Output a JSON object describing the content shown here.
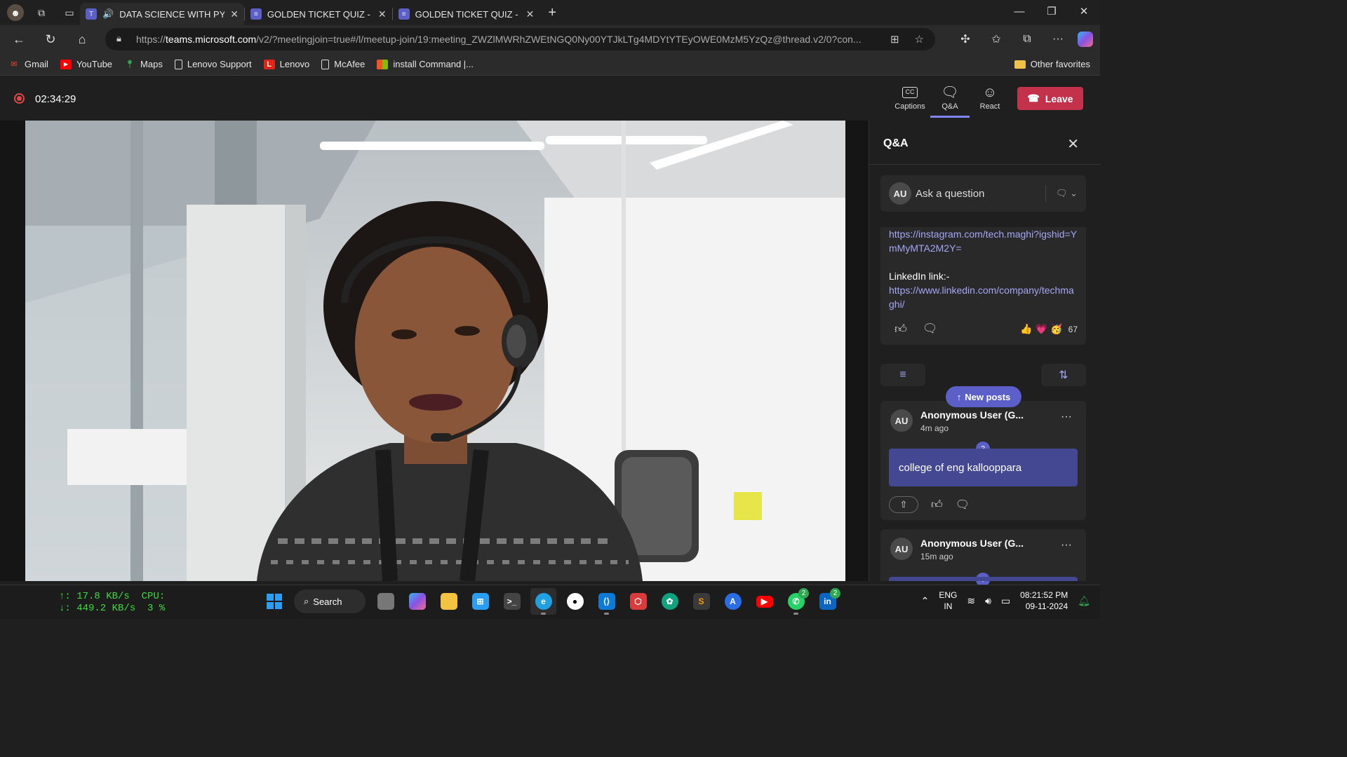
{
  "browser": {
    "tabs": [
      {
        "title": "DATA SCIENCE WITH PYTHON",
        "active": true,
        "audio": true
      },
      {
        "title": "GOLDEN TICKET QUIZ - DATA SCIENCE",
        "active": false
      },
      {
        "title": "GOLDEN TICKET QUIZ - DATA SCIENCE",
        "active": false
      }
    ],
    "url_prefix": "https://",
    "url_host": "teams.microsoft.com",
    "url_path": "/v2/?meetingjoin=true#/l/meetup-join/19:meeting_ZWZlMWRhZWEtNGQ0Ny00YTJkLTg4MDYtYTEyOWE0MzM5YzQz@thread.v2/0?con...",
    "bookmarks": [
      {
        "label": "Gmail",
        "icon": "gmail-icon",
        "color": "#ea4335"
      },
      {
        "label": "YouTube",
        "icon": "youtube-icon",
        "color": "#ff0000"
      },
      {
        "label": "Maps",
        "icon": "maps-pin-icon",
        "color": "#34a853"
      },
      {
        "label": "Lenovo Support",
        "icon": "page-icon",
        "color": "#dddddd"
      },
      {
        "label": "Lenovo",
        "icon": "lenovo-icon",
        "color": "#e2231a"
      },
      {
        "label": "McAfee",
        "icon": "page-icon",
        "color": "#dddddd"
      },
      {
        "label": "install Command |...",
        "icon": "windows-logo-icon",
        "color": "#f35325"
      }
    ],
    "other_favorites": "Other favorites"
  },
  "meeting": {
    "timer": "02:34:29",
    "buttons": {
      "captions": "Captions",
      "qa": "Q&A",
      "react": "React",
      "leave": "Leave"
    },
    "colors": {
      "leave": "#c4314b",
      "accent": "#7f85f5",
      "recording": "#e04848"
    }
  },
  "qa": {
    "title": "Q&A",
    "ask": {
      "avatar": "AU",
      "placeholder": "Ask a question"
    },
    "pinned": {
      "lines": [
        {
          "kind": "link",
          "text": "https://instagram.com/tech.maghi?igshid=YmMyMTA2M2Y="
        },
        {
          "kind": "text",
          "text": "LinkedIn link:-"
        },
        {
          "kind": "link",
          "text": "https://www.linkedin.com/company/techmaghi/"
        }
      ],
      "reactions": [
        "👍",
        "💗",
        "🥳"
      ],
      "reaction_count": "67"
    },
    "new_posts": "New posts",
    "posts": [
      {
        "avatar": "AU",
        "author": "Anonymous User (G...",
        "time": "4m ago",
        "question": "college of eng kallooppara"
      },
      {
        "avatar": "AU",
        "author": "Anonymous User (G...",
        "time": "15m ago",
        "question": ""
      }
    ]
  },
  "taskbar": {
    "net_up": "↑: 17.8 KB/s",
    "net_down": "↓: 449.2 KB/s",
    "cpu_label": "CPU:",
    "cpu_value": "3 %",
    "search": "Search",
    "apps": [
      {
        "name": "windows-start",
        "color": "#2a9df4"
      },
      {
        "name": "task-view",
        "color": "#777777"
      },
      {
        "name": "copilot",
        "color": "#8a52e3"
      },
      {
        "name": "file-explorer",
        "color": "#f5c342"
      },
      {
        "name": "microsoft-store",
        "color": "#2a9df4"
      },
      {
        "name": "terminal",
        "color": "#444444"
      },
      {
        "name": "edge",
        "color": "#1fa0e2"
      },
      {
        "name": "github",
        "color": "#222222"
      },
      {
        "name": "vscode",
        "color": "#0e7ad8"
      },
      {
        "name": "app-red",
        "color": "#d83b3b"
      },
      {
        "name": "chatgpt",
        "color": "#10a37f"
      },
      {
        "name": "sublime",
        "color": "#ff9800"
      },
      {
        "name": "app-store",
        "color": "#2a6de4"
      },
      {
        "name": "youtube",
        "color": "#ff0000"
      },
      {
        "name": "whatsapp",
        "color": "#25d366",
        "badge": "2"
      },
      {
        "name": "linkedin",
        "color": "#0a66c2",
        "badge": "2"
      }
    ],
    "lang_top": "ENG",
    "lang_bottom": "IN",
    "time": "08:21:52 PM",
    "date": "09-11-2024"
  }
}
